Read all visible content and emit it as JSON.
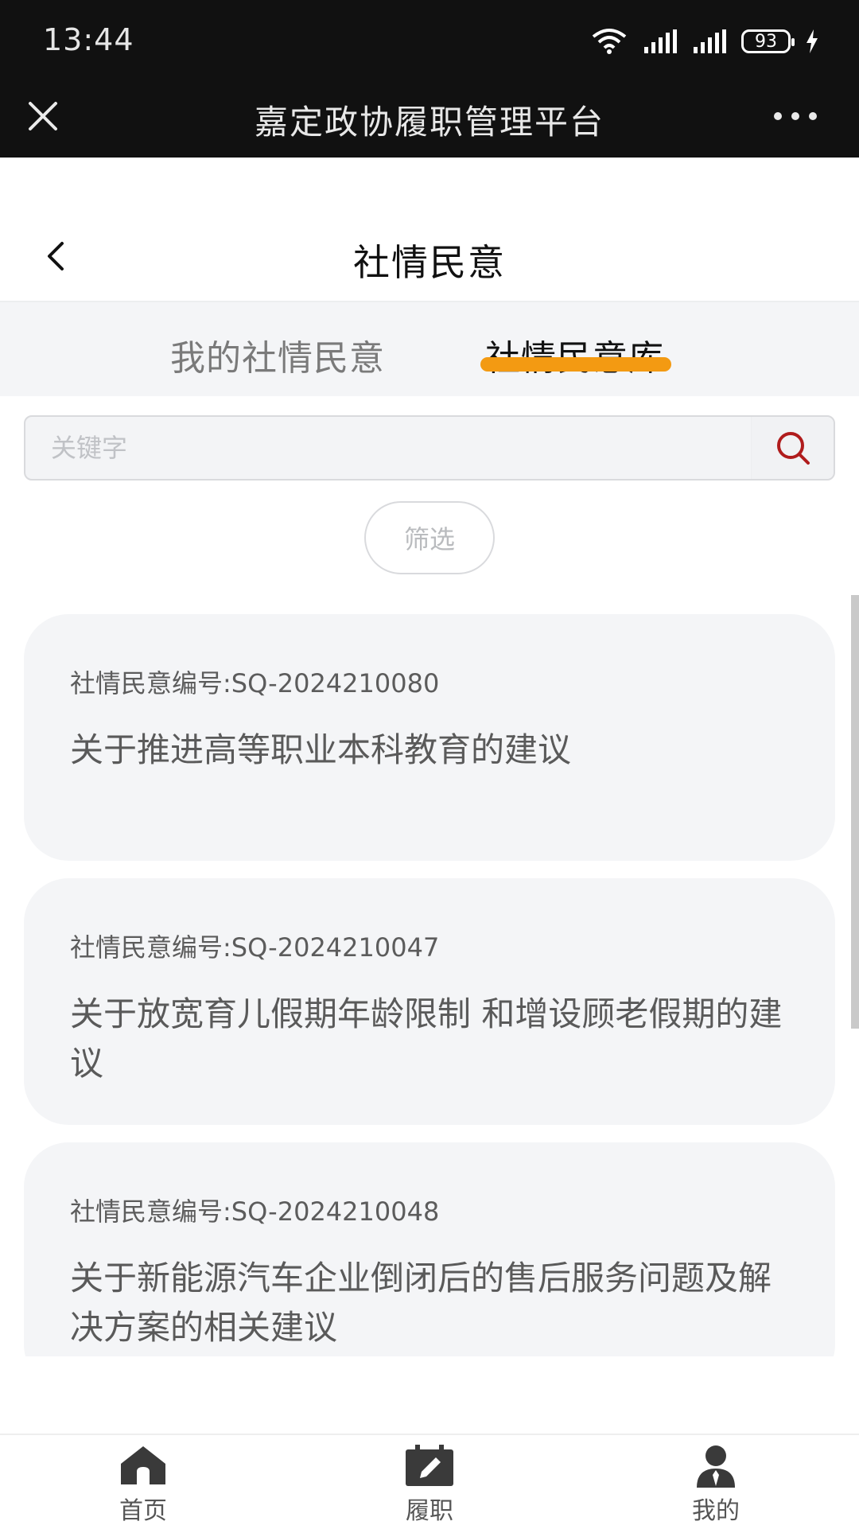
{
  "status_bar": {
    "time": "13:44",
    "battery": "93"
  },
  "app_header": {
    "title": "嘉定政协履职管理平台"
  },
  "page": {
    "title": "社情民意"
  },
  "tabs": [
    {
      "label": "我的社情民意",
      "active": false
    },
    {
      "label": "社情民意库",
      "active": true
    }
  ],
  "search": {
    "placeholder": "关键字",
    "value": ""
  },
  "filter": {
    "label": "筛选"
  },
  "cards": [
    {
      "code": "社情民意编号:SQ-2024210080",
      "title": "关于推进高等职业本科教育的建议"
    },
    {
      "code": "社情民意编号:SQ-2024210047",
      "title": "关于放宽育儿假期年龄限制 和增设顾老假期的建议"
    },
    {
      "code": "社情民意编号:SQ-2024210048",
      "title": "关于新能源汽车企业倒闭后的售后服务问题及解决方案的相关建议"
    }
  ],
  "bottom_nav": [
    {
      "label": "首页",
      "icon": "home-icon"
    },
    {
      "label": "履职",
      "icon": "edit-icon"
    },
    {
      "label": "我的",
      "icon": "user-icon"
    }
  ],
  "colors": {
    "header_bg": "#111111",
    "tab_accent": "#f39a12",
    "search_icon": "#b01c1c",
    "card_bg": "#f4f5f7"
  }
}
